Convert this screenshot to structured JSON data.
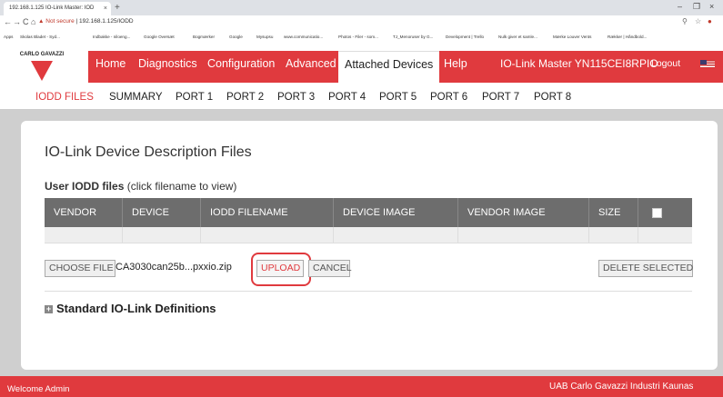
{
  "browser": {
    "tab_title": "192.168.1.125 IO-Link Master: IOD",
    "tab_close": "×",
    "new_tab": "+",
    "window_controls": [
      "–",
      "❐",
      "×"
    ],
    "nav": [
      "←",
      "→",
      "C",
      "⌂"
    ],
    "security_label": "Not secure",
    "url": "192.168.1.125/IODD",
    "bookmarks": [
      "Apps",
      "Skolas Bladet - Syd...",
      "Indbakke - niloeng...",
      "Google Oversæt",
      "Bogmærker",
      "Google",
      "Mysupsu",
      "www.communicatio...",
      "Photos - Filer - som...",
      "TJ_Menoruser by G...",
      "Development | Trello",
      "Nulk giver et samle...",
      "Mærke Louver Vents",
      "Rækker | Håndbold..."
    ]
  },
  "logo": {
    "text": "CARLO GAVAZZI"
  },
  "topnav": {
    "items": [
      "Home",
      "Diagnostics",
      "Configuration",
      "Advanced",
      "Attached Devices",
      "Help"
    ],
    "active_index": 4,
    "master": "IO-Link Master YN115CEI8RPIO",
    "logout": "Logout"
  },
  "subnav": {
    "items": [
      "IODD FILES",
      "SUMMARY",
      "PORT 1",
      "PORT 2",
      "PORT 3",
      "PORT 4",
      "PORT 5",
      "PORT 6",
      "PORT 7",
      "PORT 8"
    ],
    "active_index": 0
  },
  "page": {
    "title": "IO-Link Device Description Files",
    "subtitle_bold": "User IODD files",
    "subtitle_note": " (click filename to view)",
    "columns": [
      "VENDOR",
      "DEVICE",
      "IODD FILENAME",
      "DEVICE IMAGE",
      "VENDOR IMAGE",
      "SIZE"
    ],
    "choose_file_label": "CHOOSE FILE",
    "selected_file": "CA3030can25b...pxxio.zip",
    "upload_label": "UPLOAD",
    "cancel_label": "CANCEL",
    "delete_label": "DELETE SELECTED",
    "standard_section": "Standard IO-Link Definitions",
    "expand_symbol": "+"
  },
  "footer": {
    "welcome": "Welcome Admin",
    "company": "UAB Carlo Gavazzi Industri Kaunas"
  },
  "colors": {
    "brand": "#e03a3e",
    "table_header": "#6d6d6d"
  }
}
